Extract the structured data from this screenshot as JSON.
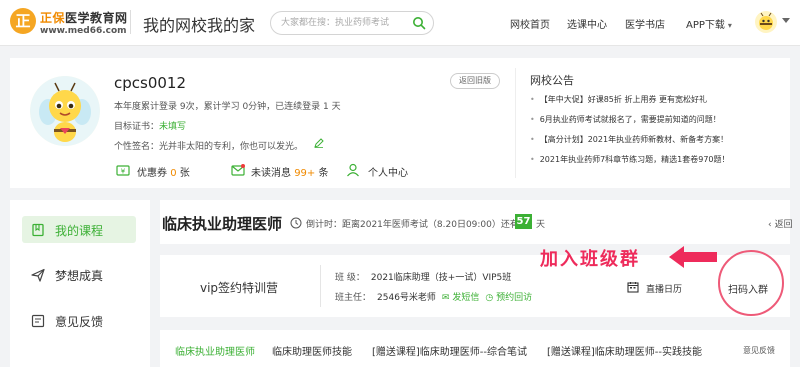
{
  "header": {
    "logo_char": "正",
    "logo_brand": "正保",
    "logo_rest": "医学教育网",
    "logo_url": "www.med66.com",
    "site_title": "我的网校我的家",
    "search_placeholder": "大家都在搜：执业药师考试",
    "nav": [
      "网校首页",
      "选课中心",
      "医学书店",
      "APP下载"
    ]
  },
  "profile": {
    "username": "cpcs0012",
    "back_old_label": "返回旧版",
    "login_stats": "本年度累计登录 9次，累计学习 0分钟，已连续登录 1 天",
    "cert_label": "目标证书：",
    "cert_value": "未填写",
    "signature": "个性签名：光并非太阳的专利，你也可以发光。",
    "coupon_label": "优惠券",
    "coupon_count": "0",
    "coupon_unit": "张",
    "messages_label": "未读消息",
    "messages_count": "99+",
    "messages_unit": "条",
    "user_center_label": "个人中心"
  },
  "notice": {
    "title": "网校公告",
    "items": [
      "【年中大促】好课85折 折上用券 更有宽松好礼",
      "6月执业药师考试就报名了，需要提前知道的问题！",
      "【高分计划】2021年执业药师新教材、新备考方案！",
      "2021年执业药师7科章节练习题，精选1套卷970题！"
    ]
  },
  "sidebar": {
    "items": [
      "我的课程",
      "梦想成真",
      "意见反馈"
    ]
  },
  "course": {
    "title": "临床执业助理医师",
    "countdown": "倒计时：距离2021年医师考试（8.20日09:00）还有",
    "days": "57",
    "days_unit": "天",
    "back_label": "返回",
    "class_name": "vip签约特训营",
    "class_label": "班  级：",
    "class_value": "2021临床助理（技+一试）VIP5班",
    "teacher_label": "班主任：",
    "teacher_value": "2546号米老师",
    "sms_label": "发短信",
    "appointment_label": "预约回访",
    "calendar_label": "直播日历",
    "annotation": "加入班级群",
    "scan_label": "扫码入群"
  },
  "tabs": {
    "items": [
      "临床执业助理医师",
      "临床助理医师技能",
      "[赠送课程]临床助理医师--综合笔试",
      "[赠送课程]临床助理医师--实践技能"
    ],
    "active_index": 0,
    "feedback_label": "意见反馈"
  },
  "colors": {
    "accent": "#3cb035",
    "brand": "#f08a00",
    "annotation": "#ee2b5b"
  }
}
